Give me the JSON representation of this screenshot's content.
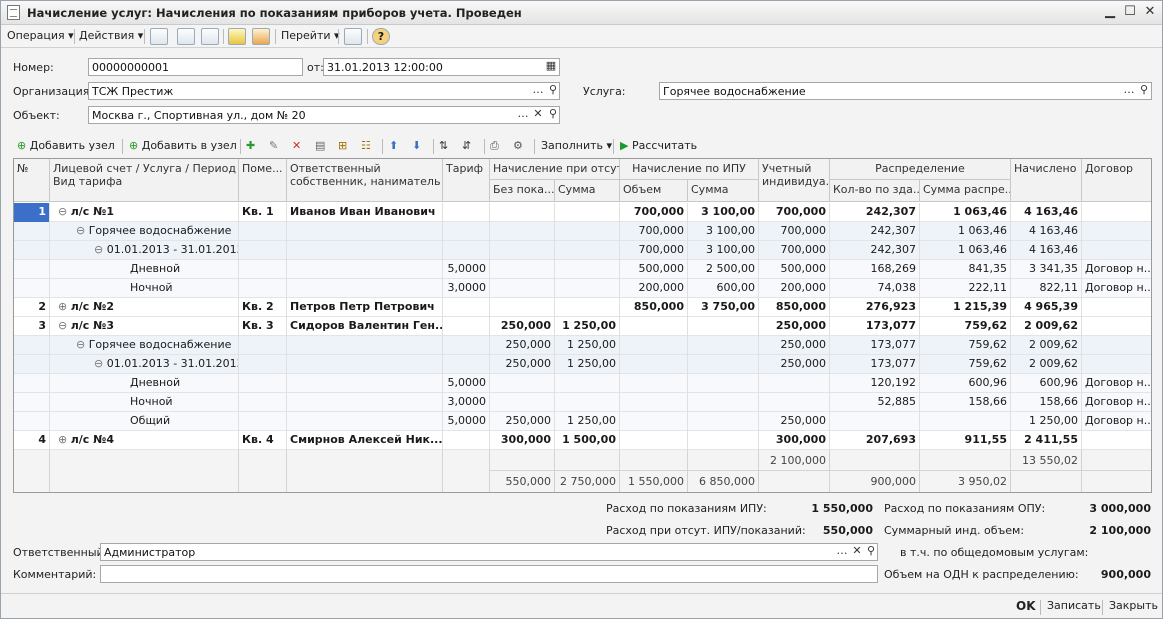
{
  "window": {
    "title": "Начисление услуг: Начисления по показаниям приборов учета. Проведен"
  },
  "toolbar": {
    "operation": "Операция",
    "actions": "Действия",
    "goto": "Перейти"
  },
  "form": {
    "number_label": "Номер:",
    "number_value": "00000000001",
    "date_label": "от:",
    "date_value": "31.01.2013 12:00:00",
    "org_label": "Организация:",
    "org_value": "ТСЖ Престиж",
    "service_label": "Услуга:",
    "service_value": "Горячее водоснабжение",
    "object_label": "Объект:",
    "object_value": "Москва г., Спортивная ул., дом № 20"
  },
  "grid_toolbar": {
    "add_node": "Добавить узел",
    "add_to_node": "Добавить в узел",
    "fill": "Заполнить",
    "calculate": "Рассчитать"
  },
  "table": {
    "headers": {
      "num": "№",
      "account": "Лицевой счет / Услуга / Период /",
      "account2": "Вид тарифа",
      "room": "Поме...",
      "owner": "Ответственный",
      "owner2": "собственник, наниматель",
      "tariff": "Тариф",
      "no_ipu": "Начисление при отсут...",
      "no_ipu_vol": "Без пока...",
      "no_ipu_sum": "Сумма",
      "ipu": "Начисление по ИПУ",
      "ipu_vol": "Объем",
      "ipu_sum": "Сумма",
      "indiv": "Учетный",
      "indiv2": "индивидуа...",
      "dist": "Распределение",
      "dist_vol": "Кол-во по зда...",
      "dist_sum": "Сумма распре...",
      "charged": "Начислено",
      "contract": "Договор"
    },
    "rows": [
      {
        "num": "1",
        "tree": "⊖",
        "account": "л/с №1",
        "room": "Кв. 1",
        "owner": "Иванов Иван Иванович",
        "tariff": "",
        "nv": "",
        "ns": "",
        "iv": "700,000",
        "is": "3 100,00",
        "ind": "700,000",
        "dv": "242,307",
        "ds": "1 063,46",
        "ch": "4 163,46",
        "ct": "",
        "level": 0,
        "bold": true,
        "sel": true
      },
      {
        "num": "",
        "tree": "⊖",
        "account": "Горячее водоснабжение",
        "room": "",
        "owner": "",
        "tariff": "",
        "nv": "",
        "ns": "",
        "iv": "700,000",
        "is": "3 100,00",
        "ind": "700,000",
        "dv": "242,307",
        "ds": "1 063,46",
        "ch": "4 163,46",
        "ct": "",
        "level": 1,
        "bold": false
      },
      {
        "num": "",
        "tree": "⊖",
        "account": "01.01.2013 - 31.01.2013",
        "room": "",
        "owner": "",
        "tariff": "",
        "nv": "",
        "ns": "",
        "iv": "700,000",
        "is": "3 100,00",
        "ind": "700,000",
        "dv": "242,307",
        "ds": "1 063,46",
        "ch": "4 163,46",
        "ct": "",
        "level": 2,
        "bold": false
      },
      {
        "num": "",
        "tree": "",
        "account": "Дневной",
        "room": "",
        "owner": "",
        "tariff": "5,0000",
        "nv": "",
        "ns": "",
        "iv": "500,000",
        "is": "2 500,00",
        "ind": "500,000",
        "dv": "168,269",
        "ds": "841,35",
        "ch": "3 341,35",
        "ct": "Договор н...",
        "level": 3,
        "bold": false
      },
      {
        "num": "",
        "tree": "",
        "account": "Ночной",
        "room": "",
        "owner": "",
        "tariff": "3,0000",
        "nv": "",
        "ns": "",
        "iv": "200,000",
        "is": "600,00",
        "ind": "200,000",
        "dv": "74,038",
        "ds": "222,11",
        "ch": "822,11",
        "ct": "Договор н...",
        "level": 3,
        "bold": false
      },
      {
        "num": "2",
        "tree": "⊕",
        "account": "л/с №2",
        "room": "Кв. 2",
        "owner": "Петров Петр Петрович",
        "tariff": "",
        "nv": "",
        "ns": "",
        "iv": "850,000",
        "is": "3 750,00",
        "ind": "850,000",
        "dv": "276,923",
        "ds": "1 215,39",
        "ch": "4 965,39",
        "ct": "",
        "level": 0,
        "bold": true
      },
      {
        "num": "3",
        "tree": "⊖",
        "account": "л/с №3",
        "room": "Кв. 3",
        "owner": "Сидоров Валентин Ген...",
        "tariff": "",
        "nv": "250,000",
        "ns": "1 250,00",
        "iv": "",
        "is": "",
        "ind": "250,000",
        "dv": "173,077",
        "ds": "759,62",
        "ch": "2 009,62",
        "ct": "",
        "level": 0,
        "bold": true
      },
      {
        "num": "",
        "tree": "⊖",
        "account": "Горячее водоснабжение",
        "room": "",
        "owner": "",
        "tariff": "",
        "nv": "250,000",
        "ns": "1 250,00",
        "iv": "",
        "is": "",
        "ind": "250,000",
        "dv": "173,077",
        "ds": "759,62",
        "ch": "2 009,62",
        "ct": "",
        "level": 1,
        "bold": false
      },
      {
        "num": "",
        "tree": "⊖",
        "account": "01.01.2013 - 31.01.2013",
        "room": "",
        "owner": "",
        "tariff": "",
        "nv": "250,000",
        "ns": "1 250,00",
        "iv": "",
        "is": "",
        "ind": "250,000",
        "dv": "173,077",
        "ds": "759,62",
        "ch": "2 009,62",
        "ct": "",
        "level": 2,
        "bold": false
      },
      {
        "num": "",
        "tree": "",
        "account": "Дневной",
        "room": "",
        "owner": "",
        "tariff": "5,0000",
        "nv": "",
        "ns": "",
        "iv": "",
        "is": "",
        "ind": "",
        "dv": "120,192",
        "ds": "600,96",
        "ch": "600,96",
        "ct": "Договор н...",
        "level": 3,
        "bold": false
      },
      {
        "num": "",
        "tree": "",
        "account": "Ночной",
        "room": "",
        "owner": "",
        "tariff": "3,0000",
        "nv": "",
        "ns": "",
        "iv": "",
        "is": "",
        "ind": "",
        "dv": "52,885",
        "ds": "158,66",
        "ch": "158,66",
        "ct": "Договор н...",
        "level": 3,
        "bold": false
      },
      {
        "num": "",
        "tree": "",
        "account": "Общий",
        "room": "",
        "owner": "",
        "tariff": "5,0000",
        "nv": "250,000",
        "ns": "1 250,00",
        "iv": "",
        "is": "",
        "ind": "250,000",
        "dv": "",
        "ds": "",
        "ch": "1 250,00",
        "ct": "Договор н...",
        "level": 3,
        "bold": false
      },
      {
        "num": "4",
        "tree": "⊕",
        "account": "л/с №4",
        "room": "Кв. 4",
        "owner": "Смирнов Алексей Ник...",
        "tariff": "",
        "nv": "300,000",
        "ns": "1 500,00",
        "iv": "",
        "is": "",
        "ind": "300,000",
        "dv": "207,693",
        "ds": "911,55",
        "ch": "2 411,55",
        "ct": "",
        "level": 0,
        "bold": true
      }
    ],
    "footer": {
      "ind_total": "2 100,000",
      "ch_total": "13 550,02",
      "nv_total": "550,000",
      "ns_total": "2 750,000",
      "iv_total": "1 550,000",
      "is_total": "6 850,000",
      "dv_total": "900,000",
      "ds_total": "3 950,02"
    }
  },
  "summary": {
    "ipu_label": "Расход по показаниям ИПУ:",
    "ipu_value": "1 550,000",
    "opu_label": "Расход по показаниям ОПУ:",
    "opu_value": "3 000,000",
    "noipu_label": "Расход при отсут. ИПУ/показаний:",
    "noipu_value": "550,000",
    "indsum_label": "Суммарный инд. объем:",
    "indsum_value": "2 100,000",
    "common_label": "в т.ч. по общедомовым услугам:",
    "odn_label": "Объем на ОДН к распределению:",
    "odn_value": "900,000"
  },
  "footer_form": {
    "responsible_label": "Ответственный:",
    "responsible_value": "Администратор",
    "comment_label": "Комментарий:",
    "comment_value": ""
  },
  "buttons": {
    "ok": "OK",
    "save": "Записать",
    "close": "Закрыть"
  }
}
